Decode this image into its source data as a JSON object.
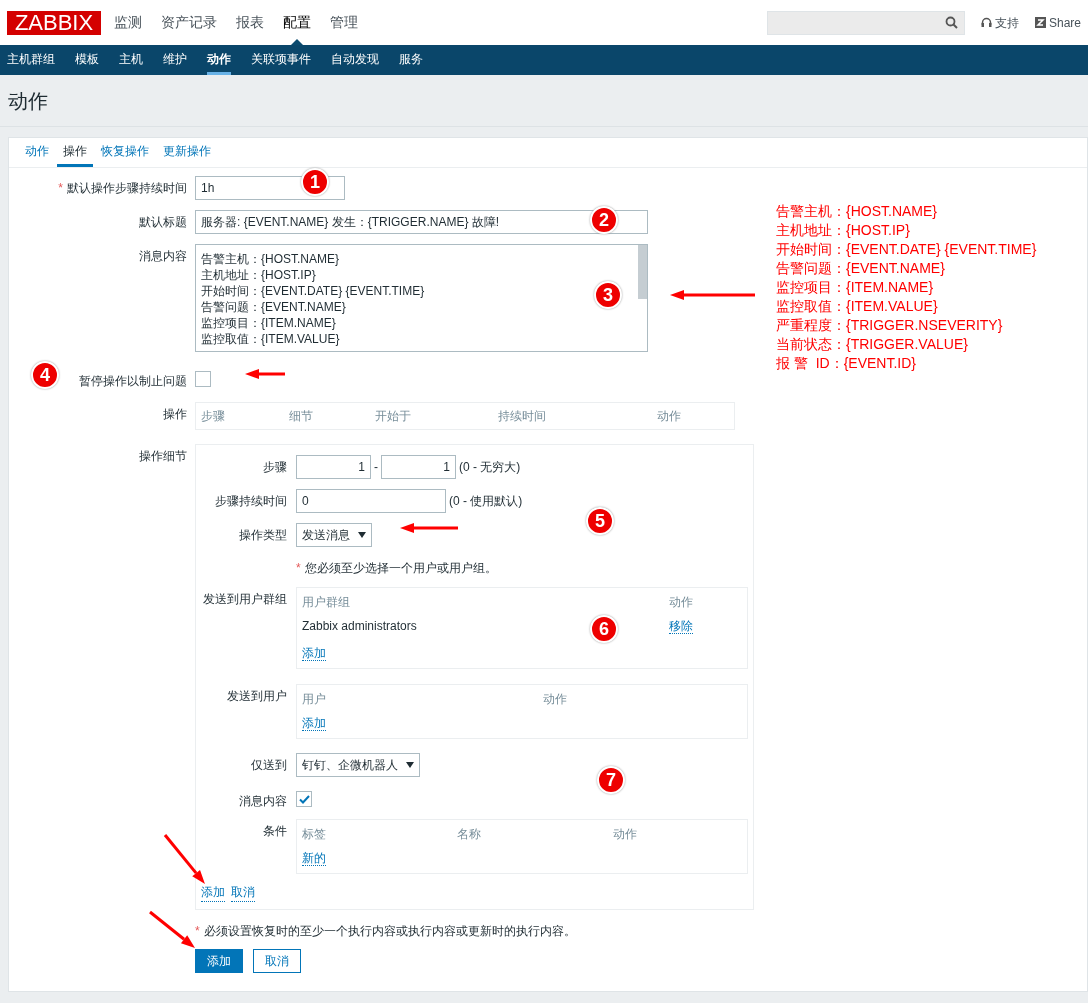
{
  "header": {
    "logo": "ZABBIX",
    "menu": [
      {
        "label": "监测",
        "selected": false
      },
      {
        "label": "资产记录",
        "selected": false
      },
      {
        "label": "报表",
        "selected": false
      },
      {
        "label": "配置",
        "selected": true
      },
      {
        "label": "管理",
        "selected": false
      }
    ],
    "support": "支持",
    "share": "Share"
  },
  "subnav": [
    {
      "label": "主机群组",
      "selected": false
    },
    {
      "label": "模板",
      "selected": false
    },
    {
      "label": "主机",
      "selected": false
    },
    {
      "label": "维护",
      "selected": false
    },
    {
      "label": "动作",
      "selected": true
    },
    {
      "label": "关联项事件",
      "selected": false
    },
    {
      "label": "自动发现",
      "selected": false
    },
    {
      "label": "服务",
      "selected": false
    }
  ],
  "page_title": "动作",
  "tabs": [
    {
      "label": "动作",
      "selected": false
    },
    {
      "label": "操作",
      "selected": true
    },
    {
      "label": "恢复操作",
      "selected": false
    },
    {
      "label": "更新操作",
      "selected": false
    }
  ],
  "form": {
    "duration": {
      "label": "默认操作步骤持续时间",
      "required_mark": "*",
      "value": "1h"
    },
    "subject": {
      "label": "默认标题",
      "value": "服务器: {EVENT.NAME} 发生：{TRIGGER.NAME} 故障!"
    },
    "message": {
      "label": "消息内容",
      "lines": [
        "告警主机：{HOST.NAME}",
        "主机地址：{HOST.IP}",
        "开始时间：{EVENT.DATE} {EVENT.TIME}",
        "告警问题：{EVENT.NAME}",
        "监控项目：{ITEM.NAME}",
        "监控取值：{ITEM.VALUE}"
      ]
    },
    "pause": {
      "label": "暂停操作以制止问题",
      "checked": false
    },
    "operations": {
      "label": "操作",
      "columns": [
        "步骤",
        "细节",
        "开始于",
        "持续时间",
        "动作"
      ]
    },
    "details": {
      "label": "操作细节",
      "steps": {
        "label": "步骤",
        "from": "1",
        "separator": "-",
        "to": "1",
        "hint": "(0 - 无穷大)"
      },
      "step_duration": {
        "label": "步骤持续时间",
        "value": "0",
        "hint": "(0 - 使用默认)"
      },
      "operation_type": {
        "label": "操作类型",
        "value": "发送消息"
      },
      "user_note": {
        "mark": "*",
        "text": "您必须至少选择一个用户或用户组。"
      },
      "user_groups": {
        "label": "发送到用户群组",
        "columns": [
          "用户群组",
          "动作"
        ],
        "rows": [
          {
            "name": "Zabbix administrators",
            "action": "移除"
          }
        ],
        "add": "添加"
      },
      "users": {
        "label": "发送到用户",
        "columns": [
          "用户",
          "动作"
        ],
        "add": "添加"
      },
      "send_only_to": {
        "label": "仅送到",
        "value": "钉钉、企微机器人"
      },
      "default_message": {
        "label": "消息内容",
        "checked": true
      },
      "conditions": {
        "label": "条件",
        "columns": [
          "标签",
          "名称",
          "动作"
        ],
        "new": "新的"
      },
      "links": [
        "添加",
        "取消"
      ]
    },
    "footer_note": {
      "mark": "*",
      "text": "必须设置恢复时的至少一个执行内容或执行内容或更新时的执行内容。"
    },
    "buttons": [
      {
        "label": "添加",
        "kind": "primary"
      },
      {
        "label": "取消",
        "kind": "secondary"
      }
    ]
  },
  "annotations": {
    "markers": [
      "1",
      "2",
      "3",
      "4",
      "5",
      "6",
      "7"
    ],
    "note": [
      "告警主机：{HOST.NAME}",
      "主机地址：{HOST.IP}",
      "开始时间：{EVENT.DATE} {EVENT.TIME}",
      "告警问题：{EVENT.NAME}",
      "监控项目：{ITEM.NAME}",
      "监控取值：{ITEM.VALUE}",
      "严重程度：{TRIGGER.NSEVERITY}",
      "当前状态：{TRIGGER.VALUE}",
      "报 警  ID：{EVENT.ID}"
    ]
  }
}
